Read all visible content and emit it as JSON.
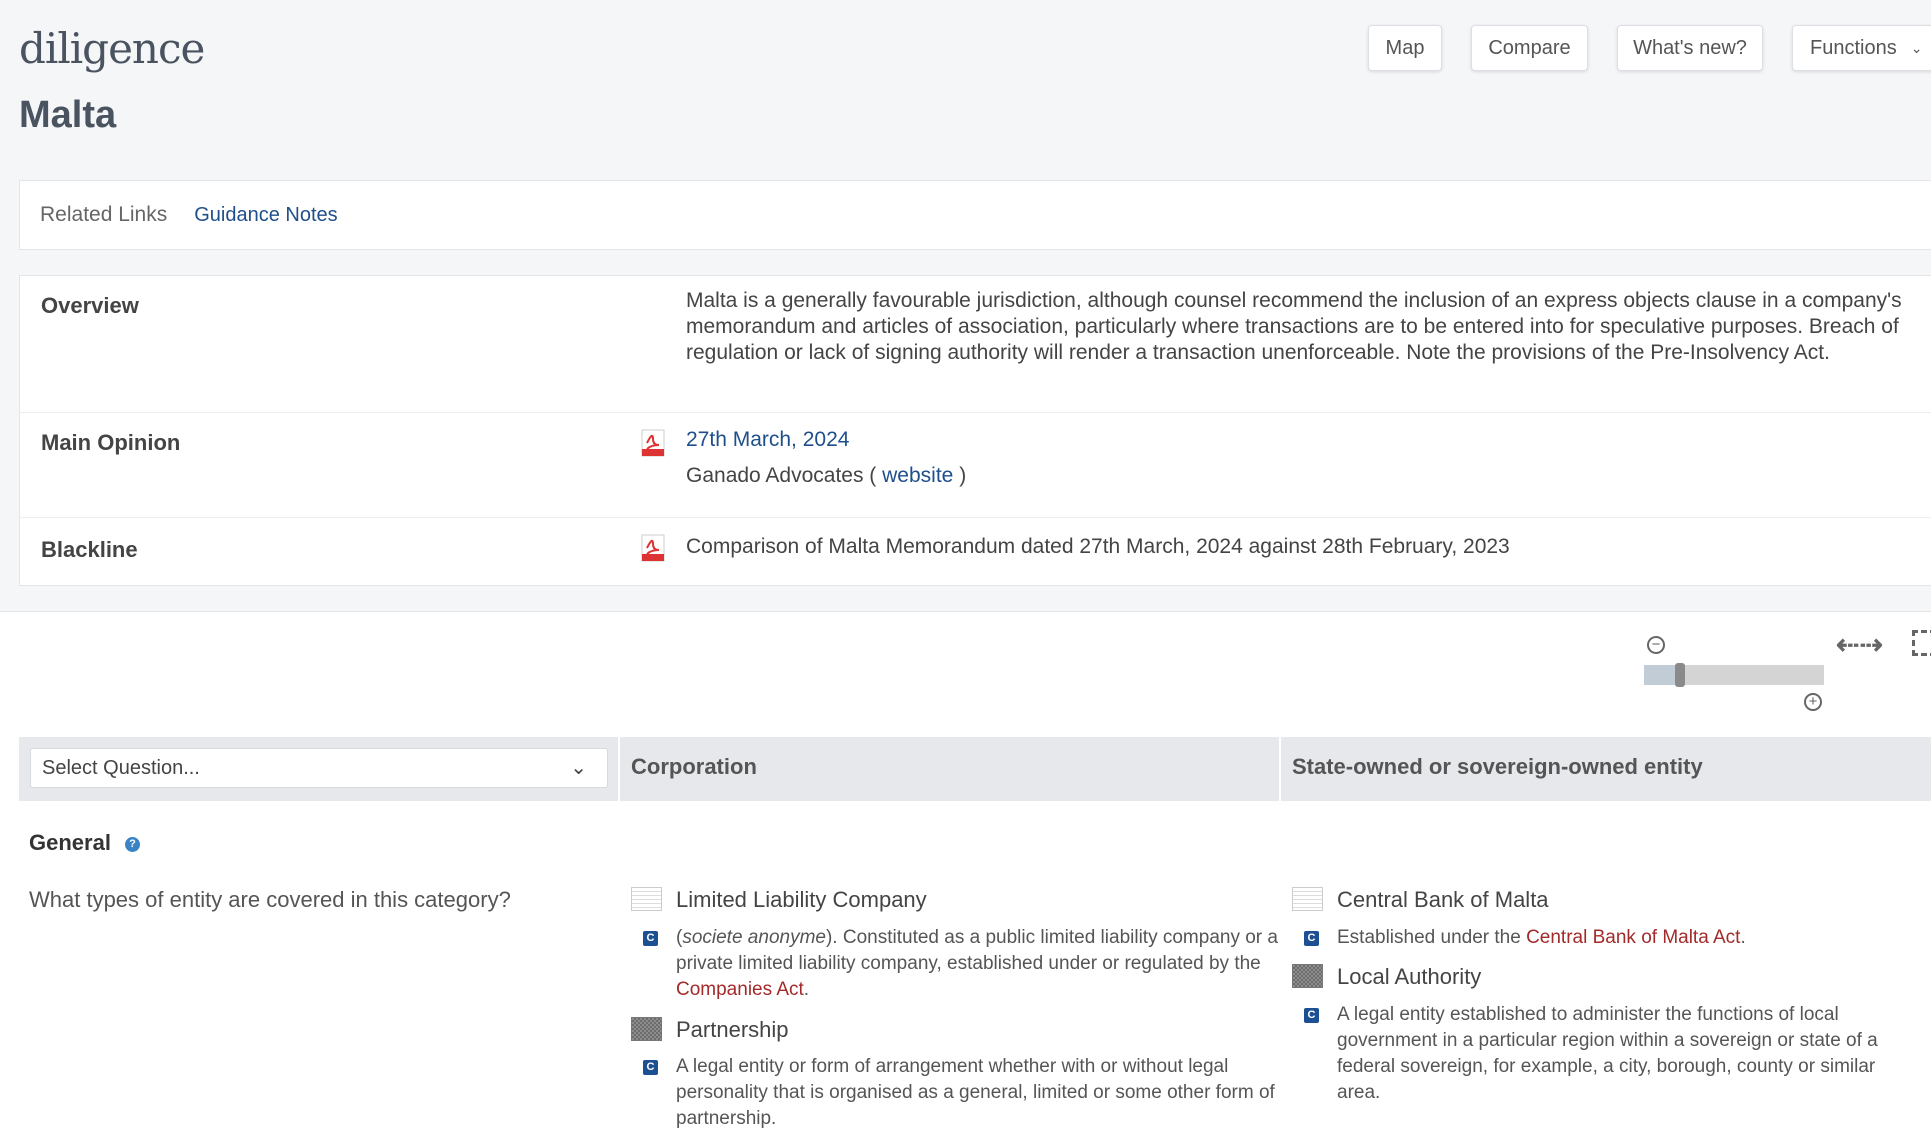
{
  "header": {
    "logo": "diligence",
    "country": "Malta",
    "buttons": {
      "map": "Map",
      "compare": "Compare",
      "whats_new": "What's new?",
      "functions": "Functions"
    }
  },
  "related": {
    "label": "Related Links",
    "guidance": "Guidance Notes"
  },
  "info": {
    "overview": {
      "label": "Overview",
      "text": "Malta is a generally favourable jurisdiction, although counsel recommend the inclusion of an express objects clause in a company's memorandum and articles of association, particularly where transactions are to be entered into for speculative purposes. Breach of regulation or lack of signing authority will render a transaction unenforceable. Note the provisions of the Pre-Insolvency Act."
    },
    "main_opinion": {
      "label": "Main Opinion",
      "date": "27th March, 2024",
      "firm": "Ganado Advocates (",
      "website": "website",
      "close": ")"
    },
    "blackline": {
      "label": "Blackline",
      "link": "Comparison of Malta Memorandum dated 27th March, 2024 against 28th February, 2023"
    }
  },
  "zoom": {
    "level_fraction": 0.2
  },
  "table": {
    "select_placeholder": "Select Question...",
    "columns": [
      "Corporation",
      "State-owned or sovereign-owned entity"
    ],
    "section": "General",
    "question": "What types of entity are covered in this category?",
    "corporation": [
      {
        "name": "Limited Liability Company",
        "italic": "societe anonyme",
        "text": "). Constituted as a public limited liability company or a private limited liability company, established under or regulated by the ",
        "link": "Companies Act",
        "end": "."
      },
      {
        "name": "Partnership",
        "text": "A legal entity or form of arrangement whether with or without legal personality that is organised as a general, limited or some other form of partnership."
      }
    ],
    "state": [
      {
        "name": "Central Bank of Malta",
        "text": "Established under the ",
        "link": "Central Bank of Malta Act",
        "end": "."
      },
      {
        "name": "Local Authority",
        "text": "A legal entity established to administer the functions of local government in a particular region within a sovereign or state of a federal sovereign, for example, a city, borough, county or similar area."
      }
    ],
    "c_badge": "C",
    "help": "?"
  }
}
